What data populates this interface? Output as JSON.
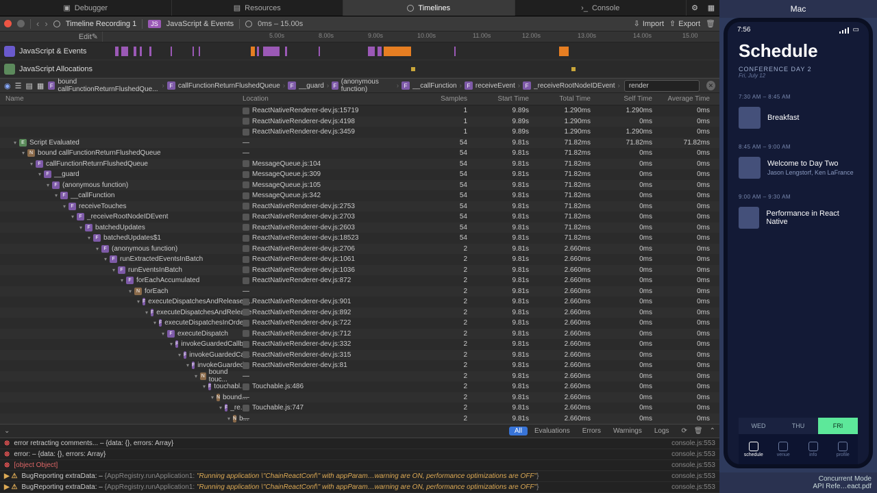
{
  "topTabs": [
    "Debugger",
    "Resources",
    "Timelines",
    "Console"
  ],
  "activeTopTab": 2,
  "toolbar": {
    "recording": "Timeline Recording 1",
    "mode": "JavaScript & Events",
    "range": "0ms – 15.00s",
    "edit": "Edit",
    "import": "Import",
    "export": "Export"
  },
  "ruler": {
    "ticks": [
      "5.00s",
      "8.00s",
      "9.00s",
      "10.00s",
      "11.00s",
      "12.00s",
      "13.00s",
      "14.00s",
      "15.00"
    ]
  },
  "timelineRows": [
    {
      "label": "JavaScript & Events",
      "kind": "js"
    },
    {
      "label": "JavaScript Allocations",
      "kind": "alloc"
    }
  ],
  "breadcrumbs": [
    {
      "icon": "f",
      "label": "bound callFunctionReturnFlushedQue..."
    },
    {
      "icon": "f",
      "label": "callFunctionReturnFlushedQueue"
    },
    {
      "icon": "f",
      "label": "__guard"
    },
    {
      "icon": "f",
      "label": "(anonymous function)"
    },
    {
      "icon": "f",
      "label": "__callFunction"
    },
    {
      "icon": "f",
      "label": "receiveEvent"
    },
    {
      "icon": "f",
      "label": "_receiveRootNodeIDEvent"
    }
  ],
  "filter": {
    "value": "render"
  },
  "columns": [
    "Name",
    "Location",
    "Samples",
    "Start Time",
    "Total Time",
    "Self Time",
    "Average Time"
  ],
  "rows": [
    {
      "indent": 0,
      "icon": "",
      "name": "",
      "loc": "ReactNativeRenderer-dev.js:15719",
      "s": "1",
      "st": "9.89s",
      "tt": "1.290ms",
      "se": "1.290ms",
      "av": "0ms"
    },
    {
      "indent": 0,
      "icon": "",
      "name": "",
      "loc": "ReactNativeRenderer-dev.js:4198",
      "s": "1",
      "st": "9.89s",
      "tt": "1.290ms",
      "se": "0ms",
      "av": "0ms"
    },
    {
      "indent": 0,
      "icon": "",
      "name": "",
      "loc": "ReactNativeRenderer-dev.js:3459",
      "s": "1",
      "st": "9.89s",
      "tt": "1.290ms",
      "se": "1.290ms",
      "av": "0ms"
    },
    {
      "indent": 1,
      "icon": "e",
      "name": "Script Evaluated",
      "loc": "—",
      "s": "54",
      "st": "9.81s",
      "tt": "71.82ms",
      "se": "71.82ms",
      "av": "71.82ms"
    },
    {
      "indent": 2,
      "icon": "n",
      "name": "bound callFunctionReturnFlushedQueue",
      "loc": "—",
      "s": "54",
      "st": "9.81s",
      "tt": "71.82ms",
      "se": "0ms",
      "av": "0ms"
    },
    {
      "indent": 3,
      "icon": "f",
      "name": "callFunctionReturnFlushedQueue",
      "loc": "MessageQueue.js:104",
      "s": "54",
      "st": "9.81s",
      "tt": "71.82ms",
      "se": "0ms",
      "av": "0ms"
    },
    {
      "indent": 4,
      "icon": "f",
      "name": "__guard",
      "loc": "MessageQueue.js:309",
      "s": "54",
      "st": "9.81s",
      "tt": "71.82ms",
      "se": "0ms",
      "av": "0ms"
    },
    {
      "indent": 5,
      "icon": "f",
      "name": "(anonymous function)",
      "loc": "MessageQueue.js:105",
      "s": "54",
      "st": "9.81s",
      "tt": "71.82ms",
      "se": "0ms",
      "av": "0ms"
    },
    {
      "indent": 6,
      "icon": "f",
      "name": "__callFunction",
      "loc": "MessageQueue.js:342",
      "s": "54",
      "st": "9.81s",
      "tt": "71.82ms",
      "se": "0ms",
      "av": "0ms"
    },
    {
      "indent": 7,
      "icon": "f",
      "name": "receiveTouches",
      "loc": "ReactNativeRenderer-dev.js:2753",
      "s": "54",
      "st": "9.81s",
      "tt": "71.82ms",
      "se": "0ms",
      "av": "0ms"
    },
    {
      "indent": 8,
      "icon": "f",
      "name": "_receiveRootNodeIDEvent",
      "loc": "ReactNativeRenderer-dev.js:2703",
      "s": "54",
      "st": "9.81s",
      "tt": "71.82ms",
      "se": "0ms",
      "av": "0ms"
    },
    {
      "indent": 9,
      "icon": "f",
      "name": "batchedUpdates",
      "loc": "ReactNativeRenderer-dev.js:2603",
      "s": "54",
      "st": "9.81s",
      "tt": "71.82ms",
      "se": "0ms",
      "av": "0ms"
    },
    {
      "indent": 10,
      "icon": "f",
      "name": "batchedUpdates$1",
      "loc": "ReactNativeRenderer-dev.js:18523",
      "s": "54",
      "st": "9.81s",
      "tt": "71.82ms",
      "se": "0ms",
      "av": "0ms"
    },
    {
      "indent": 11,
      "icon": "f",
      "name": "(anonymous function)",
      "loc": "ReactNativeRenderer-dev.js:2706",
      "s": "2",
      "st": "9.81s",
      "tt": "2.660ms",
      "se": "0ms",
      "av": "0ms"
    },
    {
      "indent": 12,
      "icon": "f",
      "name": "runExtractedEventsInBatch",
      "loc": "ReactNativeRenderer-dev.js:1061",
      "s": "2",
      "st": "9.81s",
      "tt": "2.660ms",
      "se": "0ms",
      "av": "0ms"
    },
    {
      "indent": 13,
      "icon": "f",
      "name": "runEventsInBatch",
      "loc": "ReactNativeRenderer-dev.js:1036",
      "s": "2",
      "st": "9.81s",
      "tt": "2.660ms",
      "se": "0ms",
      "av": "0ms"
    },
    {
      "indent": 14,
      "icon": "f",
      "name": "forEachAccumulated",
      "loc": "ReactNativeRenderer-dev.js:872",
      "s": "2",
      "st": "9.81s",
      "tt": "2.660ms",
      "se": "0ms",
      "av": "0ms"
    },
    {
      "indent": 15,
      "icon": "n",
      "name": "forEach",
      "loc": "—",
      "s": "2",
      "st": "9.81s",
      "tt": "2.660ms",
      "se": "0ms",
      "av": "0ms"
    },
    {
      "indent": 16,
      "icon": "f",
      "name": "executeDispatchesAndReleaseT...",
      "loc": "ReactNativeRenderer-dev.js:901",
      "s": "2",
      "st": "9.81s",
      "tt": "2.660ms",
      "se": "0ms",
      "av": "0ms"
    },
    {
      "indent": 17,
      "icon": "f",
      "name": "executeDispatchesAndRelease",
      "loc": "ReactNativeRenderer-dev.js:892",
      "s": "2",
      "st": "9.81s",
      "tt": "2.660ms",
      "se": "0ms",
      "av": "0ms"
    },
    {
      "indent": 18,
      "icon": "f",
      "name": "executeDispatchesInOrder",
      "loc": "ReactNativeRenderer-dev.js:722",
      "s": "2",
      "st": "9.81s",
      "tt": "2.660ms",
      "se": "0ms",
      "av": "0ms"
    },
    {
      "indent": 19,
      "icon": "f",
      "name": "executeDispatch",
      "loc": "ReactNativeRenderer-dev.js:712",
      "s": "2",
      "st": "9.81s",
      "tt": "2.660ms",
      "se": "0ms",
      "av": "0ms"
    },
    {
      "indent": 20,
      "icon": "f",
      "name": "invokeGuardedCallb...",
      "loc": "ReactNativeRenderer-dev.js:332",
      "s": "2",
      "st": "9.81s",
      "tt": "2.660ms",
      "se": "0ms",
      "av": "0ms"
    },
    {
      "indent": 21,
      "icon": "f",
      "name": "invokeGuardedCa...",
      "loc": "ReactNativeRenderer-dev.js:315",
      "s": "2",
      "st": "9.81s",
      "tt": "2.660ms",
      "se": "0ms",
      "av": "0ms"
    },
    {
      "indent": 22,
      "icon": "f",
      "name": "invokeGuarded...",
      "loc": "ReactNativeRenderer-dev.js:81",
      "s": "2",
      "st": "9.81s",
      "tt": "2.660ms",
      "se": "0ms",
      "av": "0ms"
    },
    {
      "indent": 23,
      "icon": "n",
      "name": "bound touc...",
      "loc": "—",
      "s": "2",
      "st": "9.81s",
      "tt": "2.660ms",
      "se": "0ms",
      "av": "0ms"
    },
    {
      "indent": 24,
      "icon": "f",
      "name": "touchabl...",
      "loc": "Touchable.js:486",
      "s": "2",
      "st": "9.81s",
      "tt": "2.660ms",
      "se": "0ms",
      "av": "0ms"
    },
    {
      "indent": 25,
      "icon": "n",
      "name": "bound...",
      "loc": "—",
      "s": "2",
      "st": "9.81s",
      "tt": "2.660ms",
      "se": "0ms",
      "av": "0ms"
    },
    {
      "indent": 26,
      "icon": "f",
      "name": "_re...",
      "loc": "Touchable.js:747",
      "s": "2",
      "st": "9.81s",
      "tt": "2.660ms",
      "se": "0ms",
      "av": "0ms"
    },
    {
      "indent": 27,
      "icon": "n",
      "name": "b...",
      "loc": "—",
      "s": "2",
      "st": "9.81s",
      "tt": "2.660ms",
      "se": "0ms",
      "av": "0ms"
    }
  ],
  "filterBar": {
    "items": [
      "All",
      "Evaluations",
      "Errors",
      "Warnings",
      "Logs"
    ],
    "active": "All"
  },
  "console": [
    {
      "kind": "err",
      "msg": "error retracting comments... – {data: {}, errors: Array}",
      "src": "console.js:553"
    },
    {
      "kind": "err",
      "msg": "error: – {data: {}, errors: Array}",
      "src": "console.js:553"
    },
    {
      "kind": "err",
      "msg": "[object Object]",
      "src": "console.js:553",
      "red": true
    },
    {
      "kind": "warn",
      "msg": "BugReporting extraData: – {AppRegistry.runApplication1: \"Running application \\\"ChainReactConf\\\" with appParam…warning are ON, performance optimizations are OFF\"}",
      "src": "console.js:553"
    },
    {
      "kind": "warn",
      "msg": "BugReporting extraData: – {AppRegistry.runApplication1: \"Running application \\\"ChainReactConf\\\" with appParam…warning are ON, performance optimizations are OFF\"}",
      "src": "console.js:553"
    }
  ],
  "mac": {
    "label": "Mac"
  },
  "phone": {
    "time": "7:56",
    "title": "Schedule",
    "dayLabel": "CONFERENCE DAY 2",
    "daySub": "Fri, July 12",
    "slots": [
      {
        "time": "7:30 AM – 8:45 AM",
        "title": "Breakfast",
        "sub": ""
      },
      {
        "time": "8:45 AM – 9:00 AM",
        "title": "Welcome to Day Two",
        "sub": "Jason Lengstorf, Ken LaFrance"
      },
      {
        "time": "9:00 AM – 9:30 AM",
        "title": "Performance in React Native",
        "sub": ""
      }
    ],
    "dayTabs": [
      "WED",
      "THU",
      "FRI"
    ],
    "activeDayTab": 2,
    "nav": [
      "schedule",
      "venue",
      "info",
      "profile"
    ]
  },
  "pdfs": [
    "Concurrent Mode",
    "API Refe…eact.pdf"
  ]
}
